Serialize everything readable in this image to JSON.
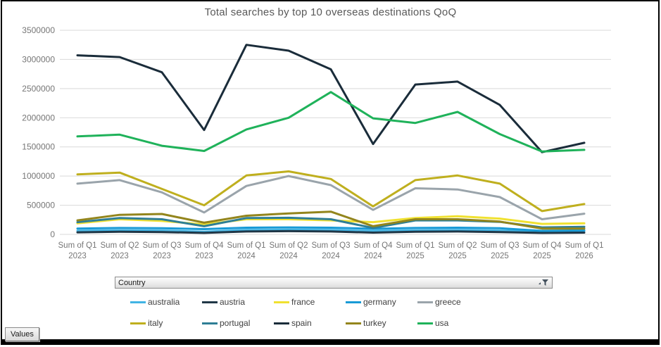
{
  "chart_data": {
    "type": "line",
    "title": "Total searches by top 10 overseas destinations QoQ",
    "categories": [
      "Sum of Q1 2023",
      "Sum of Q2 2023",
      "Sum of Q3 2023",
      "Sum of Q4 2023",
      "Sum of Q1 2024",
      "Sum of Q2 2024",
      "Sum of Q3 2024",
      "Sum of Q4 2024",
      "Sum of Q1 2025",
      "Sum of Q2 2025",
      "Sum of Q3 2025",
      "Sum of Q4 2025",
      "Sum of Q1 2026"
    ],
    "ylim": [
      0,
      3500000
    ],
    "ytick_step": 500000,
    "ytick_labels": [
      "0",
      "500000",
      "1000000",
      "1500000",
      "2000000",
      "2500000",
      "3000000",
      "3500000"
    ],
    "grid": true,
    "legend_position": "bottom",
    "series": [
      {
        "name": "australia",
        "color": "#41B4E4",
        "values": [
          60000,
          70000,
          65000,
          45000,
          75000,
          80000,
          75000,
          55000,
          70000,
          75000,
          65000,
          45000,
          55000
        ]
      },
      {
        "name": "austria",
        "color": "#203747",
        "values": [
          35000,
          45000,
          40000,
          25000,
          50000,
          55000,
          50000,
          30000,
          45000,
          50000,
          40000,
          25000,
          30000
        ]
      },
      {
        "name": "france",
        "color": "#F0E130",
        "values": [
          190000,
          260000,
          230000,
          170000,
          260000,
          260000,
          240000,
          210000,
          280000,
          310000,
          270000,
          180000,
          190000
        ]
      },
      {
        "name": "germany",
        "color": "#189AD6",
        "values": [
          100000,
          110000,
          105000,
          90000,
          115000,
          120000,
          115000,
          95000,
          110000,
          115000,
          105000,
          60000,
          70000
        ]
      },
      {
        "name": "greece",
        "color": "#9AA4AB",
        "values": [
          870000,
          930000,
          720000,
          375000,
          830000,
          1000000,
          845000,
          420000,
          790000,
          770000,
          640000,
          260000,
          355000
        ]
      },
      {
        "name": "italy",
        "color": "#BFAF1E",
        "values": [
          1030000,
          1060000,
          780000,
          500000,
          1010000,
          1080000,
          950000,
          480000,
          930000,
          1010000,
          870000,
          400000,
          520000
        ]
      },
      {
        "name": "portugal",
        "color": "#2E7E95",
        "values": [
          210000,
          280000,
          260000,
          140000,
          280000,
          285000,
          260000,
          110000,
          240000,
          240000,
          215000,
          120000,
          130000
        ]
      },
      {
        "name": "spain",
        "color": "#1A2C3A",
        "values": [
          3070000,
          3040000,
          2780000,
          1790000,
          3250000,
          3150000,
          2830000,
          1550000,
          2570000,
          2620000,
          2220000,
          1410000,
          1570000
        ]
      },
      {
        "name": "turkey",
        "color": "#93851C",
        "values": [
          240000,
          335000,
          350000,
          200000,
          320000,
          360000,
          390000,
          140000,
          260000,
          260000,
          220000,
          100000,
          100000
        ]
      },
      {
        "name": "usa",
        "color": "#1FB25A",
        "values": [
          1680000,
          1710000,
          1520000,
          1430000,
          1800000,
          2000000,
          2440000,
          1990000,
          1910000,
          2100000,
          1720000,
          1420000,
          1450000
        ]
      }
    ],
    "legend_rows": [
      [
        "australia",
        "austria",
        "france",
        "germany",
        "greece"
      ],
      [
        "italy",
        "portugal",
        "spain",
        "turkey",
        "usa"
      ]
    ]
  },
  "colors": {
    "gridline": "#D9D9D9",
    "axis_label": "#767676",
    "title": "#595959",
    "legend_text": "#404040",
    "frame": "#000000"
  },
  "filter_bar": {
    "label": "Country",
    "icon": "filter-funnel-icon"
  },
  "values_button": {
    "label": "Values"
  }
}
